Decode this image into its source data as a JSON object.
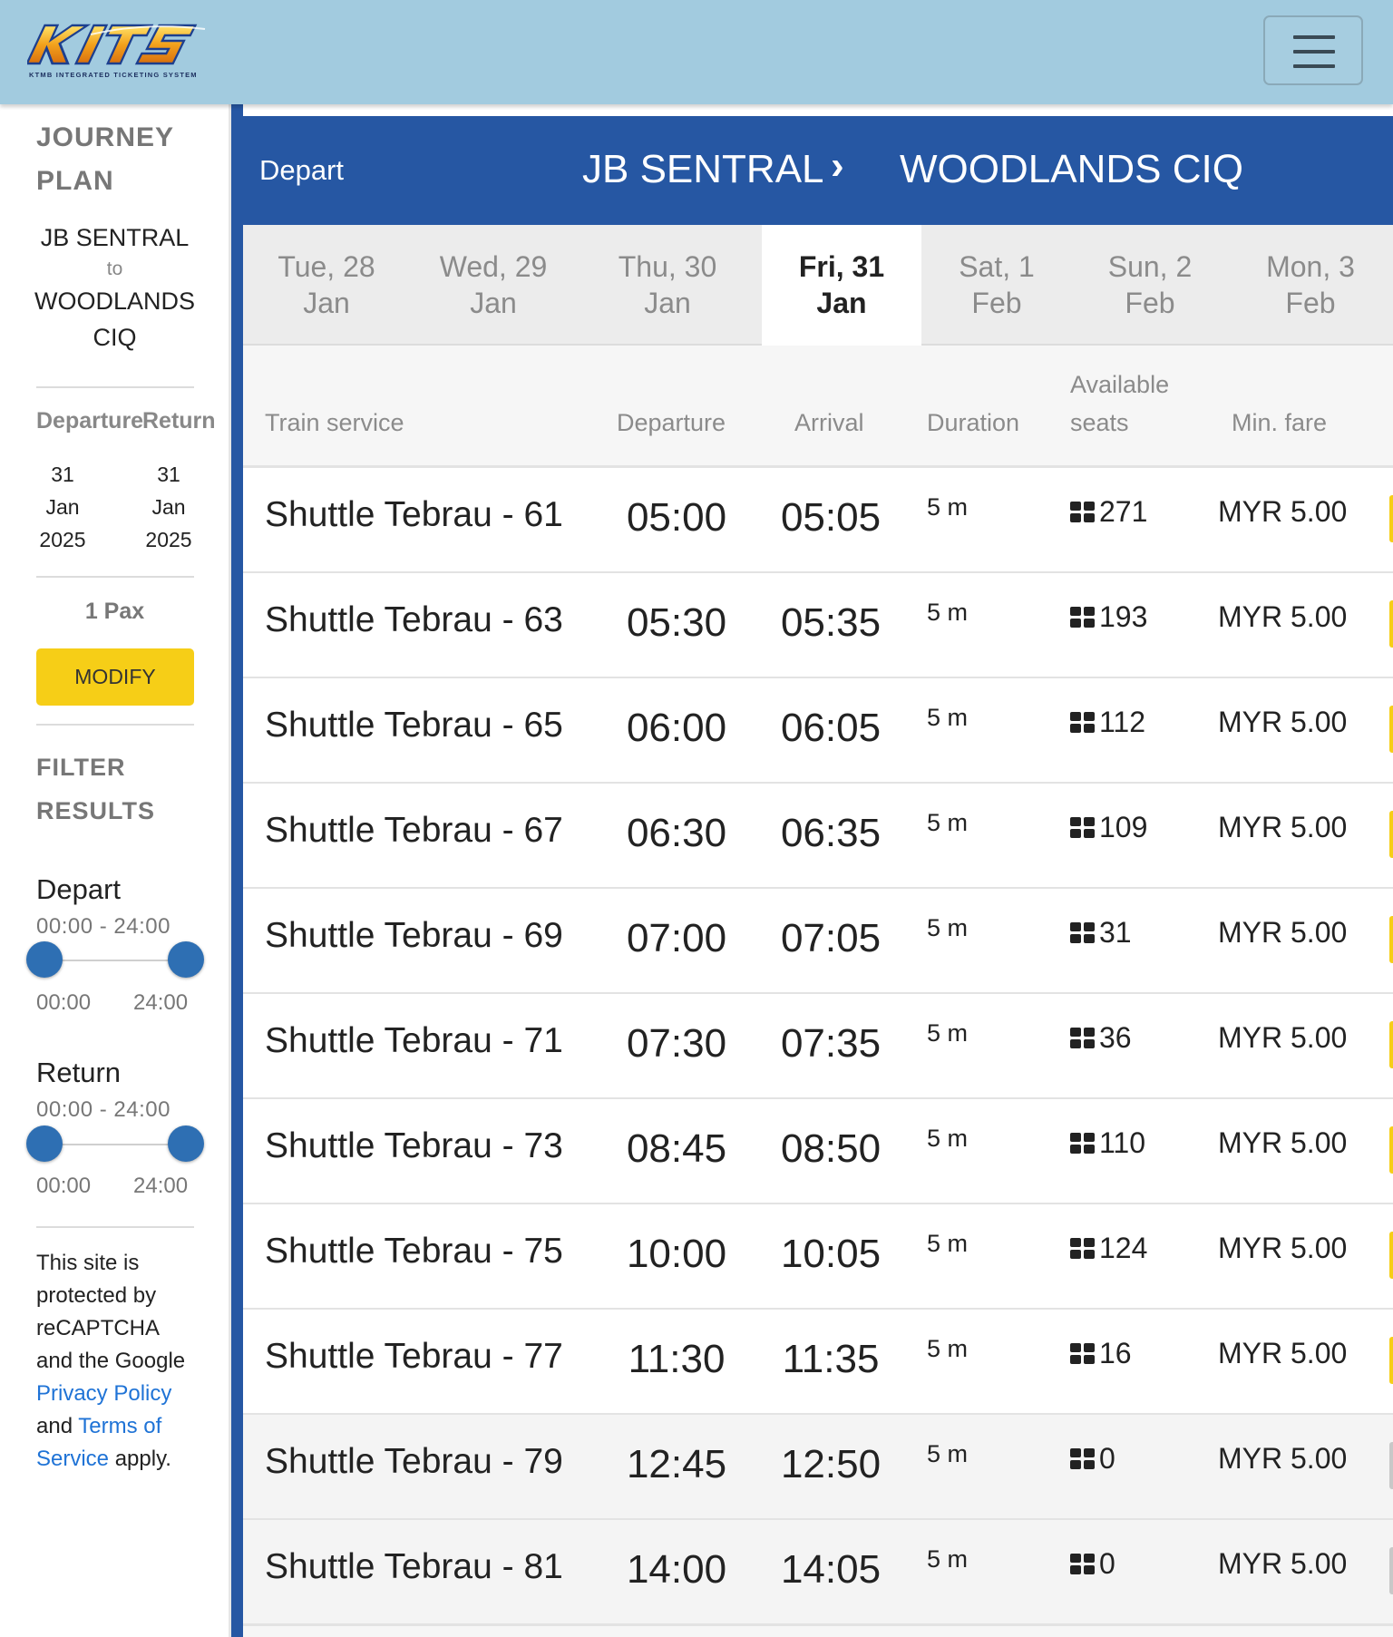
{
  "header": {
    "logo_text": "KITS",
    "logo_tagline": "KTMB INTEGRATED TICKETING SYSTEM",
    "menu_icon": "hamburger-icon"
  },
  "sidebar": {
    "title_line1": "JOURNEY",
    "title_line2": "PLAN",
    "origin": "JB SENTRAL",
    "to": "to",
    "destination_line1": "WOODLANDS",
    "destination_line2": "CIQ",
    "departure_label": "Departure",
    "return_label": "Return",
    "departure_date": {
      "day": "31",
      "month": "Jan",
      "year": "2025"
    },
    "return_date": {
      "day": "31",
      "month": "Jan",
      "year": "2025"
    },
    "pax": "1 Pax",
    "modify_label": "MODIFY",
    "filter_line1": "FILTER",
    "filter_line2": "RESULTS",
    "depart_filter": {
      "label": "Depart",
      "range": "00:00 - 24:00",
      "min": "00:00",
      "max": "24:00"
    },
    "return_filter": {
      "label": "Return",
      "range": "00:00 - 24:00",
      "min": "00:00",
      "max": "24:00"
    },
    "recaptcha": {
      "line1": "This site is",
      "line2": "protected by",
      "line3": "reCAPTCHA",
      "line4": "and the Google",
      "privacy": "Privacy Policy",
      "and": "and",
      "terms1": "Terms of",
      "terms2": "Service",
      "apply": "apply."
    }
  },
  "route": {
    "direction": "Depart",
    "from": "JB SENTRAL",
    "chevron": "›",
    "to": "WOODLANDS CIQ"
  },
  "date_tabs": [
    {
      "day": "Tue, 28",
      "month": "Jan",
      "active": false
    },
    {
      "day": "Wed, 29",
      "month": "Jan",
      "active": false
    },
    {
      "day": "Thu, 30",
      "month": "Jan",
      "active": false
    },
    {
      "day": "Fri, 31",
      "month": "Jan",
      "active": true
    },
    {
      "day": "Sat, 1",
      "month": "Feb",
      "active": false
    },
    {
      "day": "Sun, 2",
      "month": "Feb",
      "active": false
    },
    {
      "day": "Mon, 3",
      "month": "Feb",
      "active": false
    }
  ],
  "table": {
    "headers": {
      "service": "Train service",
      "departure": "Departure",
      "arrival": "Arrival",
      "duration": "Duration",
      "seats_line1": "Available",
      "seats_line2": "seats",
      "fare": "Min. fare"
    },
    "rows": [
      {
        "service": "Shuttle Tebrau - 61",
        "departure": "05:00",
        "arrival": "05:05",
        "duration": "5 m",
        "seats": "271",
        "fare": "MYR 5.00"
      },
      {
        "service": "Shuttle Tebrau - 63",
        "departure": "05:30",
        "arrival": "05:35",
        "duration": "5 m",
        "seats": "193",
        "fare": "MYR 5.00"
      },
      {
        "service": "Shuttle Tebrau - 65",
        "departure": "06:00",
        "arrival": "06:05",
        "duration": "5 m",
        "seats": "112",
        "fare": "MYR 5.00"
      },
      {
        "service": "Shuttle Tebrau - 67",
        "departure": "06:30",
        "arrival": "06:35",
        "duration": "5 m",
        "seats": "109",
        "fare": "MYR 5.00"
      },
      {
        "service": "Shuttle Tebrau - 69",
        "departure": "07:00",
        "arrival": "07:05",
        "duration": "5 m",
        "seats": "31",
        "fare": "MYR 5.00"
      },
      {
        "service": "Shuttle Tebrau - 71",
        "departure": "07:30",
        "arrival": "07:35",
        "duration": "5 m",
        "seats": "36",
        "fare": "MYR 5.00"
      },
      {
        "service": "Shuttle Tebrau - 73",
        "departure": "08:45",
        "arrival": "08:50",
        "duration": "5 m",
        "seats": "110",
        "fare": "MYR 5.00"
      },
      {
        "service": "Shuttle Tebrau - 75",
        "departure": "10:00",
        "arrival": "10:05",
        "duration": "5 m",
        "seats": "124",
        "fare": "MYR 5.00"
      },
      {
        "service": "Shuttle Tebrau - 77",
        "departure": "11:30",
        "arrival": "11:35",
        "duration": "5 m",
        "seats": "16",
        "fare": "MYR 5.00"
      },
      {
        "service": "Shuttle Tebrau - 79",
        "departure": "12:45",
        "arrival": "12:50",
        "duration": "5 m",
        "seats": "0",
        "fare": "MYR 5.00",
        "soldout": true
      },
      {
        "service": "Shuttle Tebrau - 81",
        "departure": "14:00",
        "arrival": "14:05",
        "duration": "5 m",
        "seats": "0",
        "fare": "MYR 5.00",
        "soldout": true
      }
    ]
  },
  "colors": {
    "header_bg": "#a2cbdf",
    "primary_blue": "#2657a3",
    "accent_yellow": "#f6ce17",
    "link_blue": "#1f73d6"
  }
}
